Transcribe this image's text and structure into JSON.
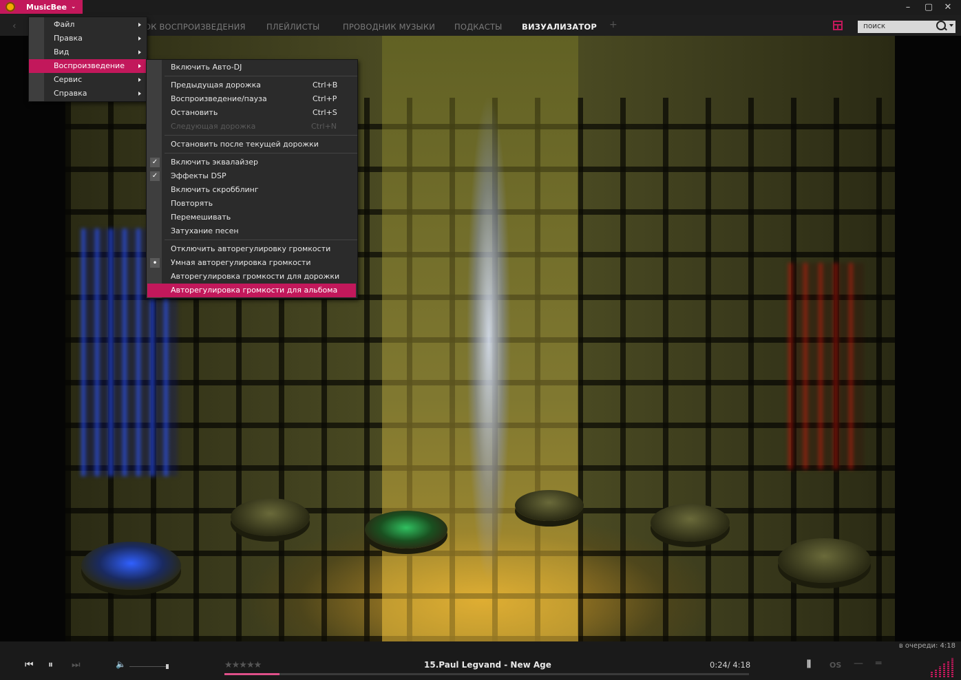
{
  "app": {
    "name": "MusicBee"
  },
  "tabs": [
    {
      "label": "ОК ВОСПРОИЗВЕДЕНИЯ",
      "active": false
    },
    {
      "label": "ПЛЕЙЛИСТЫ",
      "active": false
    },
    {
      "label": "ПРОВОДНИК МУЗЫКИ",
      "active": false
    },
    {
      "label": "ПОДКАСТЫ",
      "active": false
    },
    {
      "label": "ВИЗУАЛИЗАТОР",
      "active": true
    },
    {
      "label": "+",
      "active": false
    }
  ],
  "search": {
    "value": "поиск"
  },
  "main_menu": {
    "items": [
      {
        "label": "Файл",
        "highlighted": false
      },
      {
        "label": "Правка",
        "highlighted": false
      },
      {
        "label": "Вид",
        "highlighted": false
      },
      {
        "label": "Воспроизведение",
        "highlighted": true
      },
      {
        "label": "Сервис",
        "highlighted": false
      },
      {
        "label": "Справка",
        "highlighted": false
      }
    ]
  },
  "playback_menu": {
    "items": [
      {
        "label": "Включить Авто-DJ",
        "shortcut": ""
      },
      {
        "label": "Предыдущая дорожка",
        "shortcut": "Ctrl+B"
      },
      {
        "label": "Воспроизведение/пауза",
        "shortcut": "Ctrl+P"
      },
      {
        "label": "Остановить",
        "shortcut": "Ctrl+S"
      },
      {
        "label": "Следующая дорожка",
        "shortcut": "Ctrl+N",
        "disabled": true
      },
      {
        "label": "Остановить после текущей дорожки",
        "shortcut": ""
      },
      {
        "label": "Включить эквалайзер",
        "checked": true
      },
      {
        "label": "Эффекты DSP",
        "checked": true
      },
      {
        "label": "Включить скробблинг"
      },
      {
        "label": "Повторять"
      },
      {
        "label": "Перемешивать"
      },
      {
        "label": "Затухание песен"
      },
      {
        "label": "Отключить авторегулировку громкости"
      },
      {
        "label": "Умная авторегулировка громкости",
        "radio": true
      },
      {
        "label": "Авторегулировка громкости для дорожки"
      },
      {
        "label": "Авторегулировка громкости для альбома",
        "highlighted": true
      }
    ]
  },
  "player": {
    "queue_text": "в очереди: 4:18",
    "track": "15.Paul Legvand - New Age",
    "time": "0:24/ 4:18",
    "rating_stars": "★★★★★",
    "progress_fraction": 0.105,
    "volume_fraction": 0.95,
    "repeat_label": "OS"
  },
  "colors": {
    "accent": "#c2185b",
    "background": "#1a1a1a",
    "menu_bg": "#2b2b2b"
  },
  "icons": {
    "check": "✓",
    "radio": "•",
    "prev": "⏮",
    "pause": "⏸",
    "next": "⏭",
    "volume": "🔈"
  }
}
